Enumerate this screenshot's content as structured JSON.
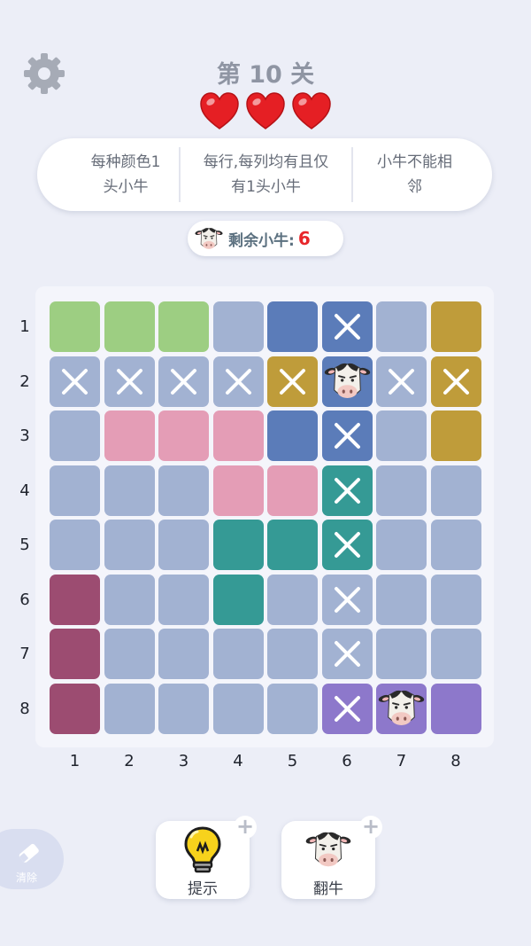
{
  "header": {
    "level_title": "第 10 关",
    "lives": 3,
    "settings_icon": "gear-icon",
    "heart_icon": "heart-icon",
    "heart_color": "#e51f24"
  },
  "rules": [
    {
      "line1": "每种颜色1",
      "line2": "头小牛"
    },
    {
      "line1": "每行,每列均有且仅",
      "line2": "有1头小牛"
    },
    {
      "line1": "小牛不能相",
      "line2": "邻"
    }
  ],
  "remaining": {
    "icon": "cow-icon",
    "label": "剩余小牛:",
    "count": "6"
  },
  "colors": {
    "G": "#9dce82",
    "L": "#a2b2d2",
    "B": "#5b7cb9",
    "O": "#bf9c3a",
    "P": "#e49db6",
    "T": "#359a95",
    "M": "#9c4c71",
    "V": "#8d78cb"
  },
  "board": {
    "row_labels": [
      "1",
      "2",
      "3",
      "4",
      "5",
      "6",
      "7",
      "8"
    ],
    "col_labels": [
      "1",
      "2",
      "3",
      "4",
      "5",
      "6",
      "7",
      "8"
    ],
    "cells": [
      [
        "G",
        "G",
        "G",
        "L",
        "B",
        "B",
        "L",
        "O"
      ],
      [
        "L",
        "L",
        "L",
        "L",
        "O",
        "B",
        "L",
        "O"
      ],
      [
        "L",
        "P",
        "P",
        "P",
        "B",
        "B",
        "L",
        "O"
      ],
      [
        "L",
        "L",
        "L",
        "P",
        "P",
        "T",
        "L",
        "L"
      ],
      [
        "L",
        "L",
        "L",
        "T",
        "T",
        "T",
        "L",
        "L"
      ],
      [
        "M",
        "L",
        "L",
        "T",
        "L",
        "L",
        "L",
        "L"
      ],
      [
        "M",
        "L",
        "L",
        "L",
        "L",
        "L",
        "L",
        "L"
      ],
      [
        "M",
        "L",
        "L",
        "L",
        "L",
        "V",
        "V",
        "V"
      ]
    ],
    "marks": [
      [
        "",
        "",
        "",
        "",
        "",
        "x",
        "",
        ""
      ],
      [
        "x",
        "x",
        "x",
        "x",
        "x",
        "cow",
        "x",
        "x"
      ],
      [
        "",
        "",
        "",
        "",
        "",
        "x",
        "",
        ""
      ],
      [
        "",
        "",
        "",
        "",
        "",
        "x",
        "",
        ""
      ],
      [
        "",
        "",
        "",
        "",
        "",
        "x",
        "",
        ""
      ],
      [
        "",
        "",
        "",
        "",
        "",
        "x",
        "",
        ""
      ],
      [
        "",
        "",
        "",
        "",
        "",
        "x",
        "",
        ""
      ],
      [
        "",
        "",
        "",
        "",
        "",
        "x",
        "cow",
        ""
      ]
    ]
  },
  "toolbar": {
    "clear_label": "清除",
    "clear_icon": "eraser-icon",
    "hint_label": "提示",
    "hint_icon": "lightbulb-icon",
    "flip_label": "翻牛",
    "flip_icon": "cow-icon",
    "plus_symbol": "+"
  }
}
